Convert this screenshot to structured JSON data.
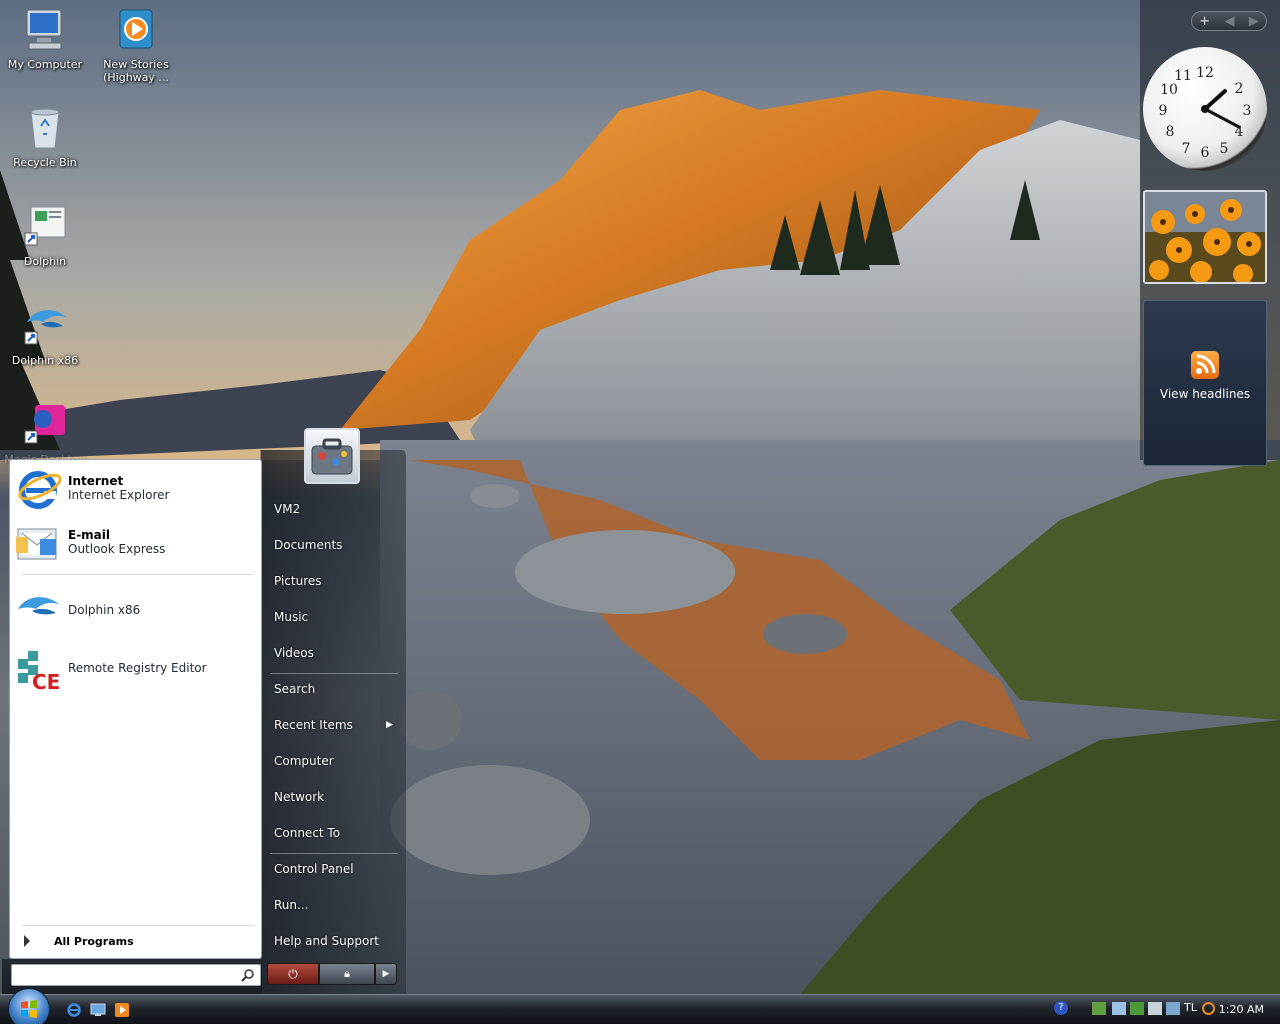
{
  "desktop": {
    "icons": [
      {
        "label": "My Computer"
      },
      {
        "label": "New Stories (Highway ..."
      },
      {
        "label": "Recycle Bin"
      },
      {
        "label": "Dolphin"
      },
      {
        "label": "Dolphin x86"
      },
      {
        "label": "Magic Desktop"
      }
    ]
  },
  "sidebar": {
    "feed_label": "View headlines",
    "clock": {
      "time": "1:20"
    }
  },
  "start_menu": {
    "pinned": [
      {
        "title": "Internet",
        "subtitle": "Internet Explorer"
      },
      {
        "title": "E-mail",
        "subtitle": "Outlook Express"
      }
    ],
    "recent": [
      {
        "title": "Dolphin x86"
      },
      {
        "title": "Remote Registry Editor"
      }
    ],
    "all_programs": "All Programs",
    "search_placeholder": "",
    "right_items": [
      "VM2",
      "Documents",
      "Pictures",
      "Music",
      "Videos",
      "Search",
      "Recent Items",
      "Computer",
      "Network",
      "Connect To",
      "Control Panel",
      "Run...",
      "Help and Support"
    ]
  },
  "taskbar": {
    "time": "1:20 AM"
  },
  "colors": {
    "taskbar": "#1a1f26",
    "start_left_bg": "#ffffff",
    "ie_blue": "#1f6fd0"
  }
}
